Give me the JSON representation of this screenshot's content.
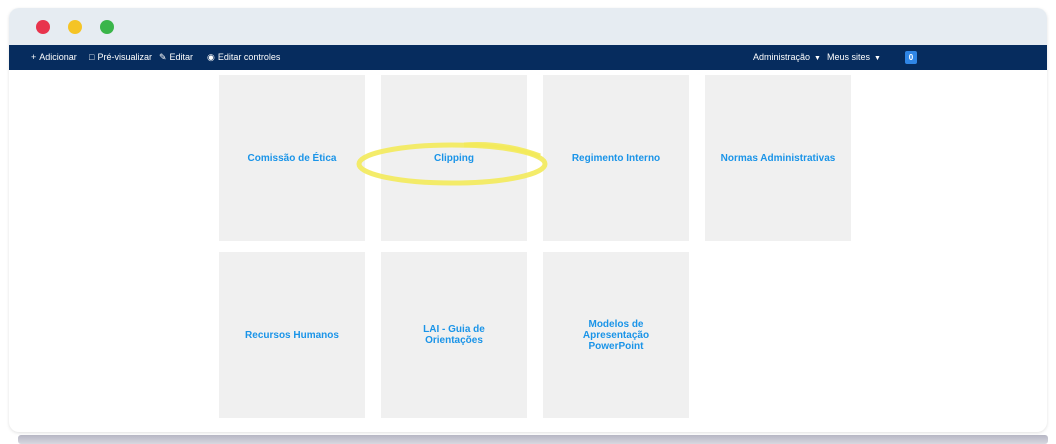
{
  "window": {
    "traffic_lights": {
      "close": "#e8344d",
      "minimize": "#f5c426",
      "maximize": "#3ab54a"
    }
  },
  "toolbar": {
    "left_items": [
      {
        "icon": "plus-icon",
        "label": "Adicionar"
      },
      {
        "icon": "monitor-icon",
        "label": "Pré-visualizar"
      },
      {
        "icon": "edit-icon",
        "label": "Editar"
      },
      {
        "icon": "eye-icon",
        "label": "Editar controles"
      }
    ],
    "right_items": [
      {
        "label": "Administração",
        "icon": "caret-down-icon"
      },
      {
        "label": "Meus sites",
        "icon": "caret-down-icon"
      }
    ],
    "badge": "0"
  },
  "tiles": [
    {
      "label": "Comissão de Ética"
    },
    {
      "label": "Clipping",
      "highlighted": true
    },
    {
      "label": "Regimento Interno"
    },
    {
      "label": "Normas Administrativas"
    },
    {
      "label": "Recursos Humanos"
    },
    {
      "label": "LAI - Guia de Orientações"
    },
    {
      "label": "Modelos de Apresentação PowerPoint"
    }
  ],
  "colors": {
    "toolbar_bg": "#062c5e",
    "tile_bg": "#f0f0f0",
    "tile_text": "#1a94e8",
    "highlight": "#f3ea5a"
  }
}
